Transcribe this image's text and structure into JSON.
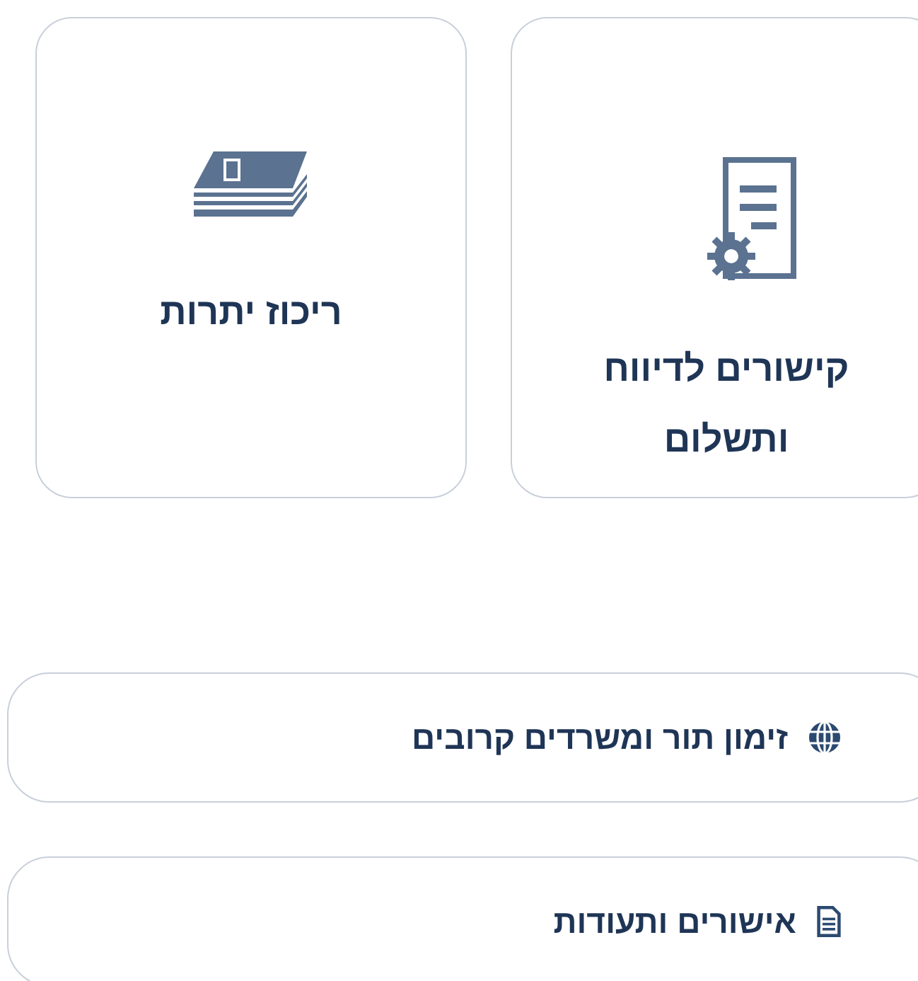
{
  "tiles": [
    {
      "label": "קישורים לדיווח ותשלום",
      "kind": "report"
    },
    {
      "label": "ריכוז יתרות",
      "kind": "cash"
    }
  ],
  "links": [
    {
      "label": "זימון תור ומשרדים קרובים",
      "kind": "globe"
    },
    {
      "label": "אישורים ותעודות",
      "kind": "document"
    }
  ]
}
